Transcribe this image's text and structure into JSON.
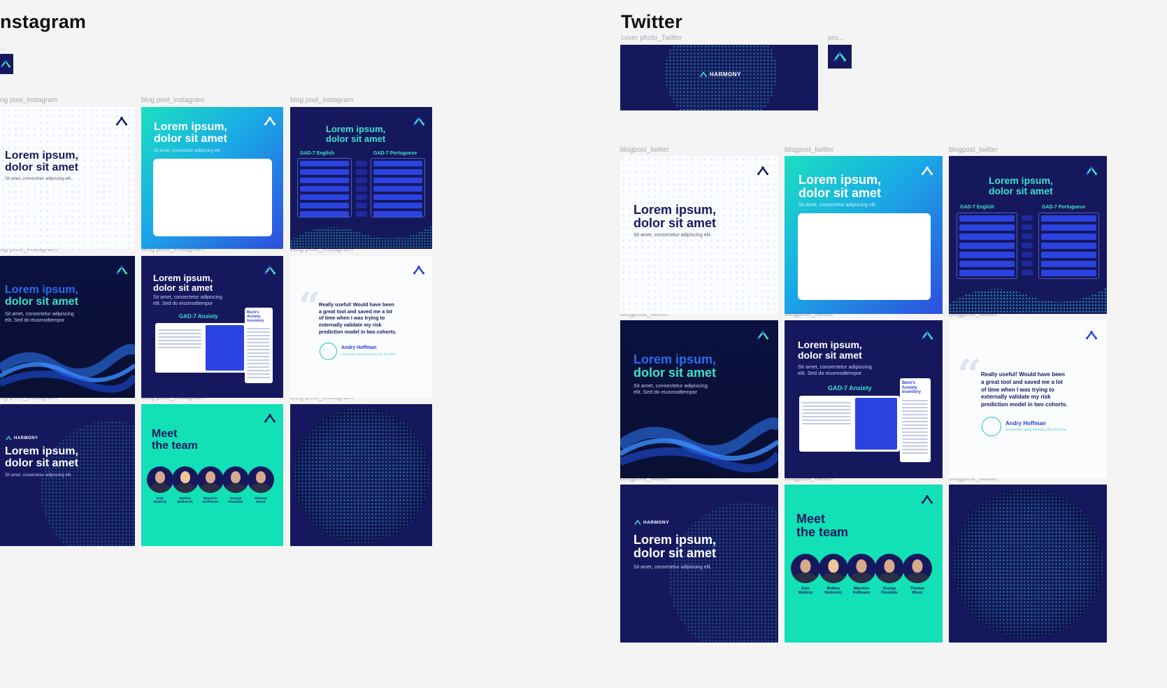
{
  "sections": {
    "instagram_title": "nstagram",
    "twitter_title": "Twitter"
  },
  "labels": {
    "ig_profile": "...",
    "ig_post": "og post_instagram",
    "ig_blog": "blog post_instagram",
    "tw_cover": "cover photo_Twitter",
    "tw_pro": "pro...",
    "tw_blog": "blogpost_twitter"
  },
  "content": {
    "headline_1": "Lorem ipsum,",
    "headline_2": "dolor sit amet",
    "sub_short": "Sit amet, consectetur adipiscing elit.",
    "sub_long_1": "Sit amet, consectetur adipiscing",
    "sub_long_2": "elit. Sed do eiusmodtempor",
    "gad_english": "GAD-7 English",
    "gad_portuguese": "GAD-7 Portuguese",
    "gad7_anxiety": "GAD-7 Anxiety",
    "beck_title_1": "Beck's",
    "beck_title_2": "Anxiety",
    "beck_title_3": "Inventory",
    "quote_line_1": "Really useful! Would have been",
    "quote_line_2": "a great tool and saved me a lot",
    "quote_line_3": "of time when I was trying to",
    "quote_line_4": "externally validate my risk",
    "quote_line_5": "prediction model in two cohorts.",
    "quote_name": "Andry Hoffman",
    "quote_role": "researcher using harmony the first time",
    "harmony": "HARMONY",
    "meet_1": "Meet",
    "meet_2": "the team",
    "team": [
      {
        "first": "Eoin",
        "last": "McElroy"
      },
      {
        "first": "Bettina",
        "last": "Moltrecht,"
      },
      {
        "first": "Mauricio",
        "last": "Hoffmann"
      },
      {
        "first": "George",
        "last": "Ploubidis"
      },
      {
        "first": "Thomas",
        "last": "Wood"
      }
    ]
  },
  "colors": {
    "navy": "#16185e",
    "teal": "#12e0b6",
    "blue": "#2b43e0",
    "canvas": "#f4f4f5"
  }
}
